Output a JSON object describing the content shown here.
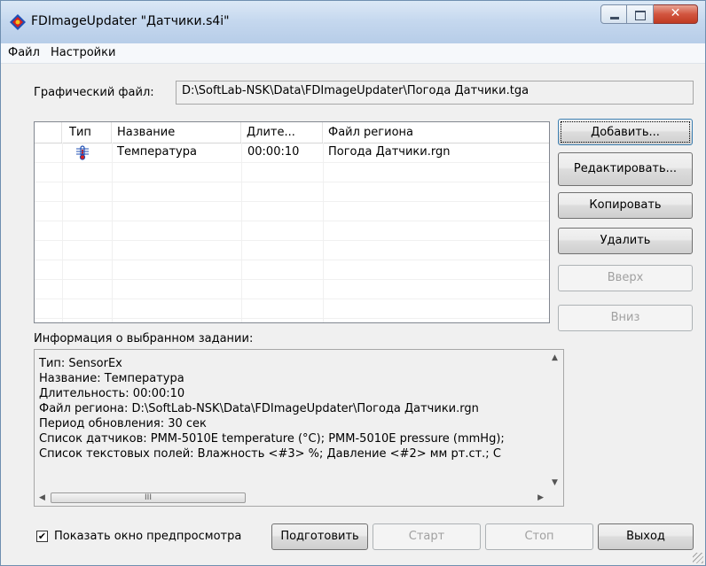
{
  "window": {
    "title": "FDImageUpdater \"Датчики.s4i\""
  },
  "menu": {
    "file": "Файл",
    "settings": "Настройки"
  },
  "graphic_file": {
    "label": "Графический файл:",
    "value": "D:\\SoftLab-NSK\\Data\\FDImageUpdater\\Погода Датчики.tga"
  },
  "table": {
    "columns": [
      "Тип",
      "Название",
      "Длите...",
      "Файл региона"
    ],
    "rows": [
      {
        "type_icon": "thermometer-icon",
        "name": "Температура",
        "duration": "00:00:10",
        "region_file": "Погода Датчики.rgn"
      }
    ]
  },
  "side_buttons": {
    "add": "Добавить...",
    "edit": "Редактировать...",
    "copy": "Копировать",
    "delete": "Удалить",
    "up": "Вверх",
    "down": "Вниз"
  },
  "info": {
    "label": "Информация о выбранном задании:",
    "lines": [
      "Тип: SensorEx",
      "Название: Температура",
      "Длительность: 00:00:10",
      "Файл региона: D:\\SoftLab-NSK\\Data\\FDImageUpdater\\Погода Датчики.rgn",
      "Период обновления: 30 сек",
      "Список датчиков: PMM-5010E temperature (°C); PMM-5010E pressure (mmHg);",
      "Список текстовых полей: Влажность <#3> %; Давление <#2> мм рт.ст.; С"
    ]
  },
  "bottom": {
    "preview_checkbox": "Показать окно предпросмотра",
    "preview_checked": true,
    "prepare": "Подготовить",
    "start": "Старт",
    "stop": "Стоп",
    "exit": "Выход"
  },
  "colors": {
    "titlebar": "#c4d7ee",
    "close_button": "#c03a22",
    "icon_blue": "#1f4fb5",
    "icon_red": "#d62020"
  }
}
